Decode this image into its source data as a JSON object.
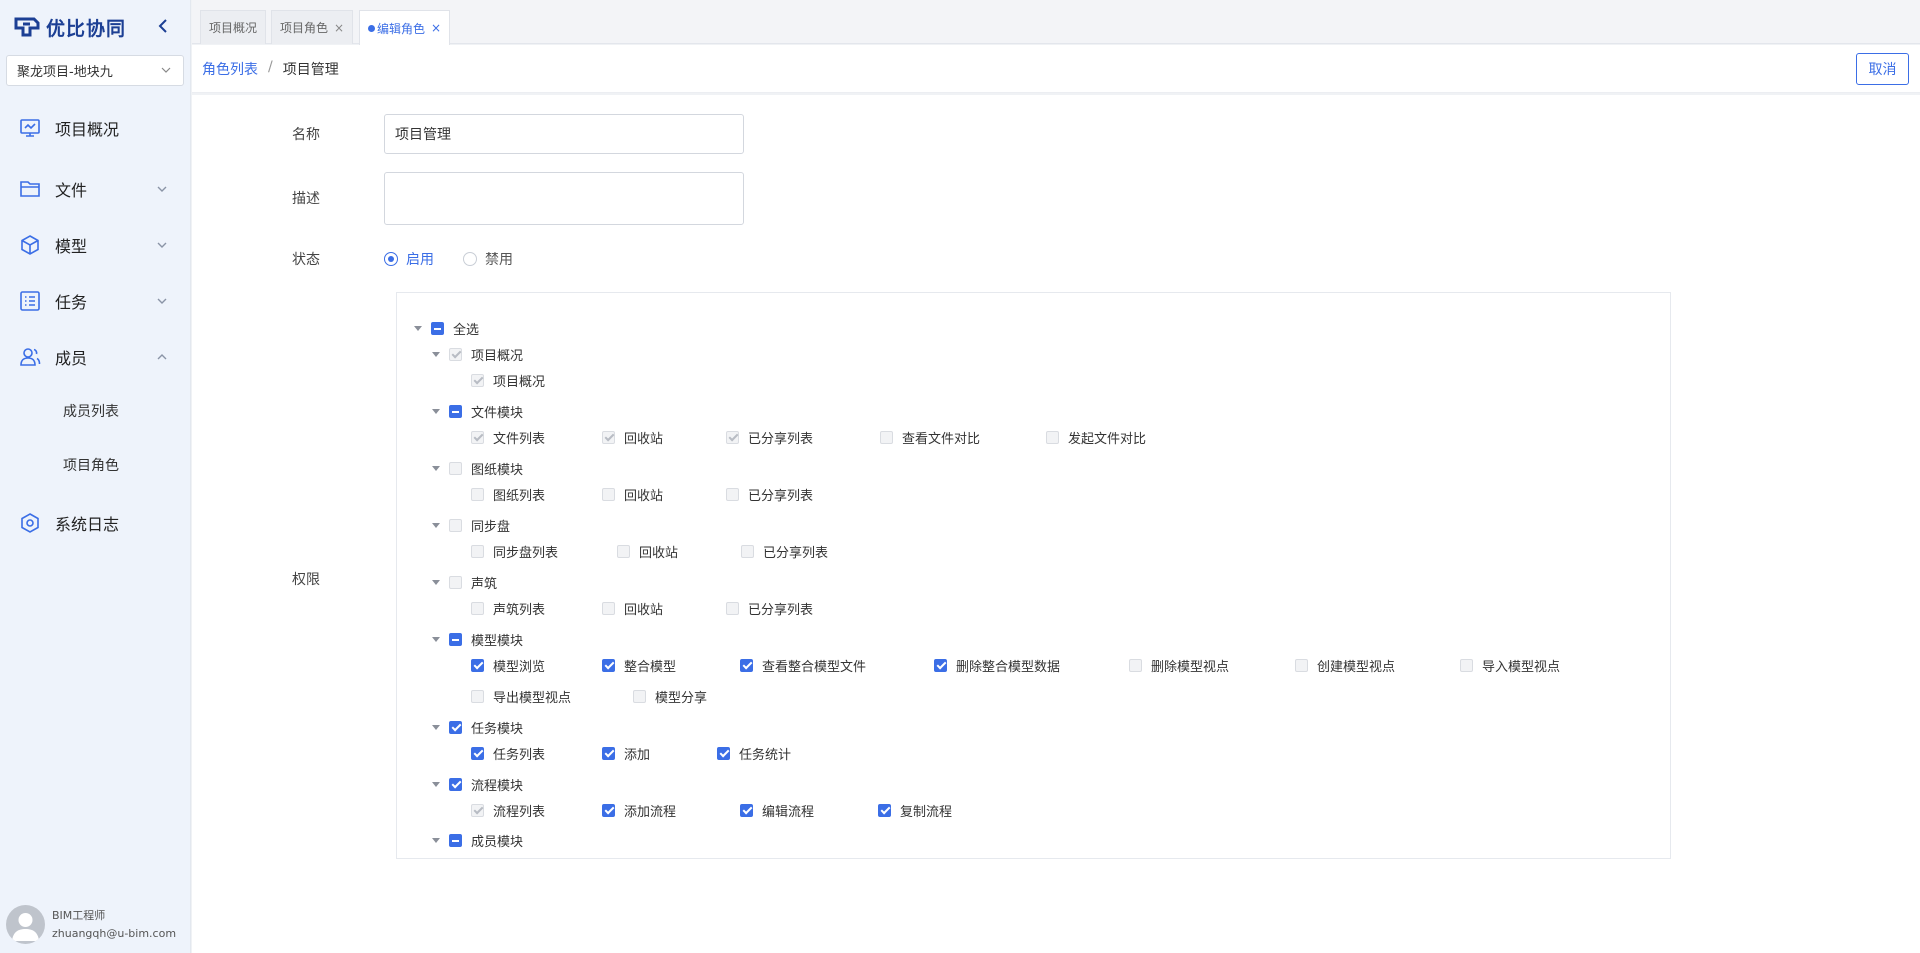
{
  "app": {
    "logo_text": "优比协同"
  },
  "project_select": {
    "value": "聚龙项目-地块九"
  },
  "sidebar": {
    "items": [
      {
        "label": "项目概况",
        "icon": "monitor-icon"
      },
      {
        "label": "文件",
        "icon": "folder-icon"
      },
      {
        "label": "模型",
        "icon": "cube-icon"
      },
      {
        "label": "任务",
        "icon": "task-list-icon"
      },
      {
        "label": "成员",
        "icon": "users-icon"
      },
      {
        "label": "系统日志",
        "icon": "hexagon-gear-icon"
      }
    ],
    "members_sub": [
      "成员列表",
      "项目角色"
    ]
  },
  "user": {
    "role": "BIM工程师",
    "email": "zhuangqh@u-bim.com"
  },
  "tabs": [
    {
      "label": "项目概况"
    },
    {
      "label": "项目角色",
      "close": "×"
    },
    {
      "label": "编辑角色",
      "close": "×"
    }
  ],
  "breadcrumb": {
    "link": "角色列表",
    "sep": "/",
    "current": "项目管理"
  },
  "actions": {
    "cancel": "取消"
  },
  "form": {
    "name_label": "名称",
    "name_value": "项目管理",
    "desc_label": "描述",
    "desc_value": "",
    "status_label": "状态",
    "status_on": "启用",
    "status_off": "禁用",
    "status_selected": "启用",
    "perm_label": "权限"
  },
  "tree": {
    "root": "全选",
    "groups": [
      {
        "label": "项目概况",
        "state": "disabled-checked",
        "children": [
          {
            "label": "项目概况",
            "state": "disabled-checked"
          }
        ]
      },
      {
        "label": "文件模块",
        "state": "indeterminate",
        "children": [
          {
            "label": "文件列表",
            "state": "disabled-checked"
          },
          {
            "label": "回收站",
            "state": "disabled-checked"
          },
          {
            "label": "已分享列表",
            "state": "disabled-checked"
          },
          {
            "label": "查看文件对比",
            "state": "disabled"
          },
          {
            "label": "发起文件对比",
            "state": "disabled"
          }
        ]
      },
      {
        "label": "图纸模块",
        "state": "disabled",
        "children": [
          {
            "label": "图纸列表",
            "state": "disabled"
          },
          {
            "label": "回收站",
            "state": "disabled"
          },
          {
            "label": "已分享列表",
            "state": "disabled"
          }
        ]
      },
      {
        "label": "同步盘",
        "state": "disabled",
        "children": [
          {
            "label": "同步盘列表",
            "state": "disabled"
          },
          {
            "label": "回收站",
            "state": "disabled"
          },
          {
            "label": "已分享列表",
            "state": "disabled"
          }
        ]
      },
      {
        "label": "声筑",
        "state": "disabled",
        "children": [
          {
            "label": "声筑列表",
            "state": "disabled"
          },
          {
            "label": "回收站",
            "state": "disabled"
          },
          {
            "label": "已分享列表",
            "state": "disabled"
          }
        ]
      },
      {
        "label": "模型模块",
        "state": "indeterminate",
        "children": [
          {
            "label": "模型浏览",
            "state": "checked"
          },
          {
            "label": "整合模型",
            "state": "checked"
          },
          {
            "label": "查看整合模型文件",
            "state": "checked"
          },
          {
            "label": "删除整合模型数据",
            "state": "checked"
          },
          {
            "label": "删除模型视点",
            "state": "disabled"
          },
          {
            "label": "创建模型视点",
            "state": "disabled"
          },
          {
            "label": "导入模型视点",
            "state": "disabled"
          },
          {
            "label": "导出模型视点",
            "state": "disabled"
          },
          {
            "label": "模型分享",
            "state": "disabled"
          }
        ]
      },
      {
        "label": "任务模块",
        "state": "checked",
        "children": [
          {
            "label": "任务列表",
            "state": "checked"
          },
          {
            "label": "添加",
            "state": "checked"
          },
          {
            "label": "任务统计",
            "state": "checked"
          }
        ]
      },
      {
        "label": "流程模块",
        "state": "checked",
        "children": [
          {
            "label": "流程列表",
            "state": "disabled-checked"
          },
          {
            "label": "添加流程",
            "state": "checked"
          },
          {
            "label": "编辑流程",
            "state": "checked"
          },
          {
            "label": "复制流程",
            "state": "checked"
          }
        ]
      },
      {
        "label": "成员模块",
        "state": "indeterminate",
        "children": []
      }
    ]
  }
}
